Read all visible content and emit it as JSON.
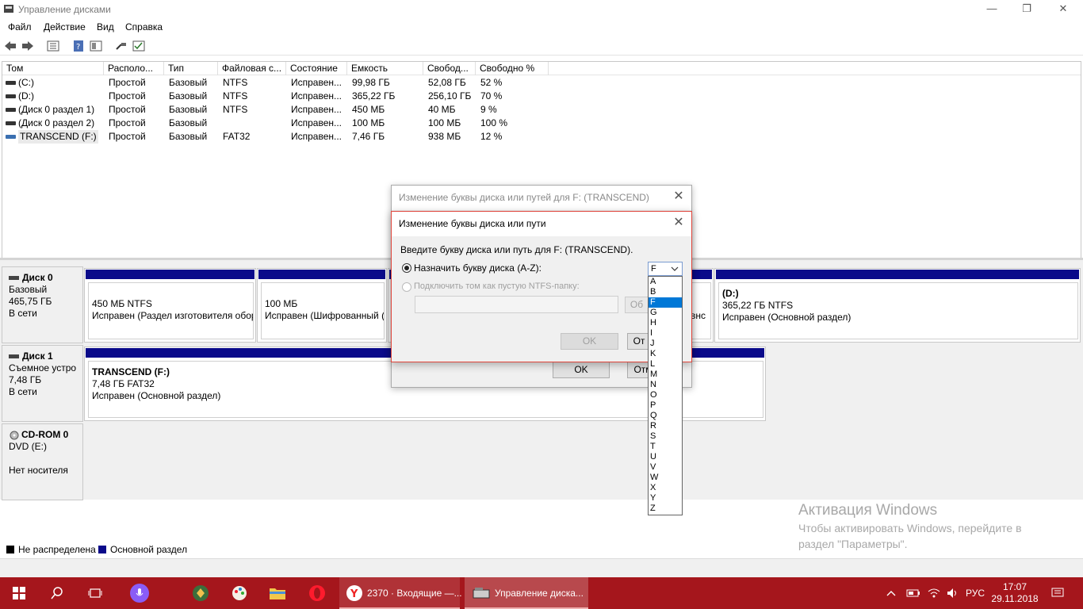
{
  "window": {
    "title": "Управление дисками",
    "minimize": "—",
    "restore": "❐",
    "close": "✕"
  },
  "menu": [
    "Файл",
    "Действие",
    "Вид",
    "Справка"
  ],
  "toolbar": {
    "icons": [
      "back-icon",
      "forward-icon",
      "properties-icon",
      "help-icon",
      "console-icon",
      "connect-icon",
      "settings-icon"
    ]
  },
  "volumes": {
    "columns": [
      "Том",
      "Располо...",
      "Тип",
      "Файловая с...",
      "Состояние",
      "Емкость",
      "Свобод...",
      "Свободно %"
    ],
    "rows": [
      [
        "(C:)",
        "Простой",
        "Базовый",
        "NTFS",
        "Исправен...",
        "99,98 ГБ",
        "52,08 ГБ",
        "52 %"
      ],
      [
        "(D:)",
        "Простой",
        "Базовый",
        "NTFS",
        "Исправен...",
        "365,22 ГБ",
        "256,10 ГБ",
        "70 %"
      ],
      [
        "(Диск 0 раздел 1)",
        "Простой",
        "Базовый",
        "NTFS",
        "Исправен...",
        "450 МБ",
        "40 МБ",
        "9 %"
      ],
      [
        "(Диск 0 раздел 2)",
        "Простой",
        "Базовый",
        "",
        "Исправен...",
        "100 МБ",
        "100 МБ",
        "100 %"
      ],
      [
        "TRANSCEND (F:)",
        "Простой",
        "Базовый",
        "FAT32",
        "Исправен...",
        "7,46 ГБ",
        "938 МБ",
        "12 %"
      ]
    ]
  },
  "disks": {
    "disk0": {
      "name": "Диск 0",
      "type": "Базовый",
      "size": "465,75 ГБ",
      "status": "В сети",
      "parts": [
        {
          "line1": "450 МБ NTFS",
          "line2": "Исправен (Раздел изготовителя обор"
        },
        {
          "line1": "100 МБ",
          "line2": "Исправен (Шифрованный ("
        },
        {
          "line1": "",
          "line2": "овнс"
        },
        {
          "title": "(D:)",
          "line1": "365,22 ГБ NTFS",
          "line2": "Исправен (Основной раздел)"
        }
      ]
    },
    "disk1": {
      "name": "Диск 1",
      "type": "Съемное устро",
      "size": "7,48 ГБ",
      "status": "В сети",
      "part": {
        "title": "TRANSCEND  (F:)",
        "line1": "7,48 ГБ FAT32",
        "line2": "Исправен (Основной раздел)"
      }
    },
    "cdrom": {
      "name": "CD-ROM 0",
      "type": "DVD (E:)",
      "status": "Нет носителя"
    }
  },
  "legend": {
    "unallocated": "Не распределена",
    "primary": "Основной раздел",
    "unallocated_color": "#000000",
    "primary_color": "#0a0a8a"
  },
  "dialog_back": {
    "title": "Изменение буквы диска или путей для F: (TRANSCEND)",
    "ok": "OK",
    "cancel": "Отм"
  },
  "dialog_front": {
    "title": "Изменение буквы диска или пути",
    "prompt": "Введите букву диска или путь для F: (TRANSCEND).",
    "option_letter": "Назначить букву диска (A-Z):",
    "option_folder": "Подключить том как пустую NTFS-папку:",
    "browse": "Об",
    "ok": "OK",
    "cancel": "От",
    "selected_letter": "F"
  },
  "drive_letters": [
    "A",
    "B",
    "F",
    "G",
    "H",
    "I",
    "J",
    "K",
    "L",
    "M",
    "N",
    "O",
    "P",
    "Q",
    "R",
    "S",
    "T",
    "U",
    "V",
    "W",
    "X",
    "Y",
    "Z"
  ],
  "watermark": {
    "title": "Активация Windows",
    "line1": "Чтобы активировать Windows, перейдите в",
    "line2": "раздел \"Параметры\"."
  },
  "taskbar": {
    "mail_label": "2370 · Входящие —...",
    "diskmgmt_label": "Управление диска...",
    "language": "РУС",
    "time": "17:07",
    "date": "29.11.2018"
  }
}
